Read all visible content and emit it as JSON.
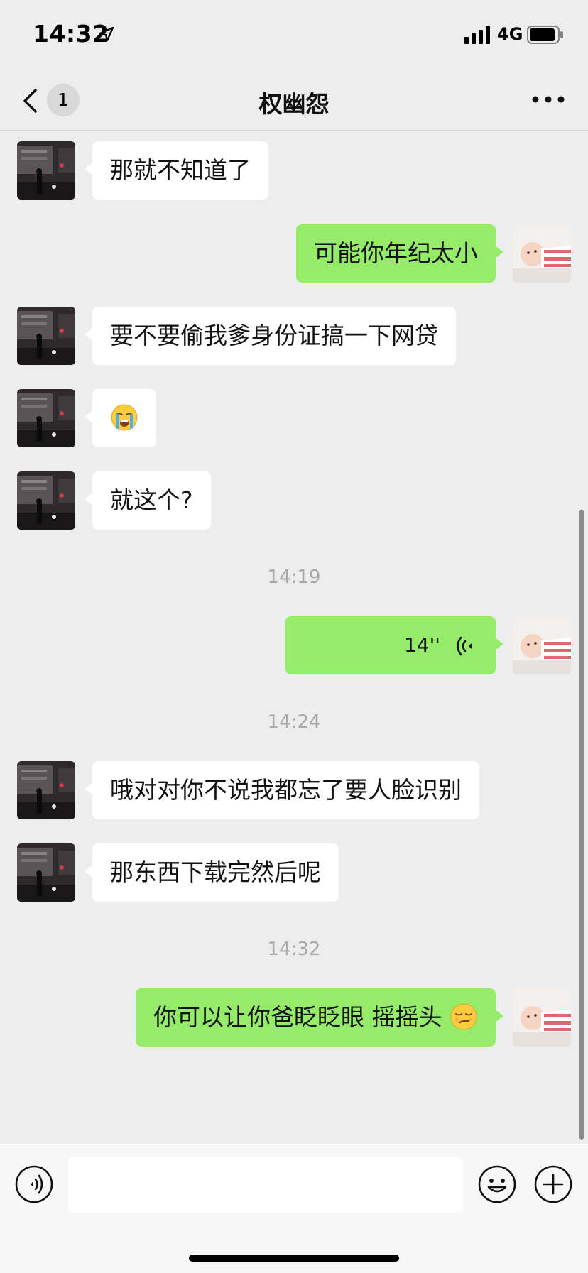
{
  "status_bar": {
    "time": "14:32",
    "network": "4G"
  },
  "nav": {
    "unread_count": "1",
    "title": "权幽怨"
  },
  "icons": {
    "back": "chevron-left-icon",
    "more": "more-dots-icon",
    "location": "location-arrow-icon",
    "signal": "signal-bars-icon",
    "battery": "battery-icon",
    "voice_message": "voice-wave-icon",
    "voice_toggle": "voice-input-icon",
    "emoji_button": "smiley-icon",
    "plus_button": "plus-circle-icon"
  },
  "colors": {
    "sent_bubble": "#95ec69",
    "received_bubble": "#ffffff",
    "background": "#ededed"
  },
  "messages": [
    {
      "side": "left",
      "text": "那就不知道了"
    },
    {
      "side": "right",
      "text": "可能你年纪太小"
    },
    {
      "side": "left",
      "text": "要不要偷我爹身份证搞一下网贷"
    },
    {
      "side": "left",
      "emoji": "loudly-crying-face"
    },
    {
      "side": "left",
      "text": "就这个?"
    },
    {
      "timestamp": "14:19"
    },
    {
      "side": "right",
      "voice_duration": "14''"
    },
    {
      "timestamp": "14:24"
    },
    {
      "side": "left",
      "text": "哦对对你不说我都忘了要人脸识别"
    },
    {
      "side": "left",
      "text": "那东西下载完然后呢"
    },
    {
      "timestamp": "14:32"
    },
    {
      "side": "right",
      "text": "你可以让你爸眨眨眼 摇摇头",
      "trailing_emoji": "smirking-face"
    }
  ],
  "input": {
    "placeholder": "",
    "value": ""
  }
}
